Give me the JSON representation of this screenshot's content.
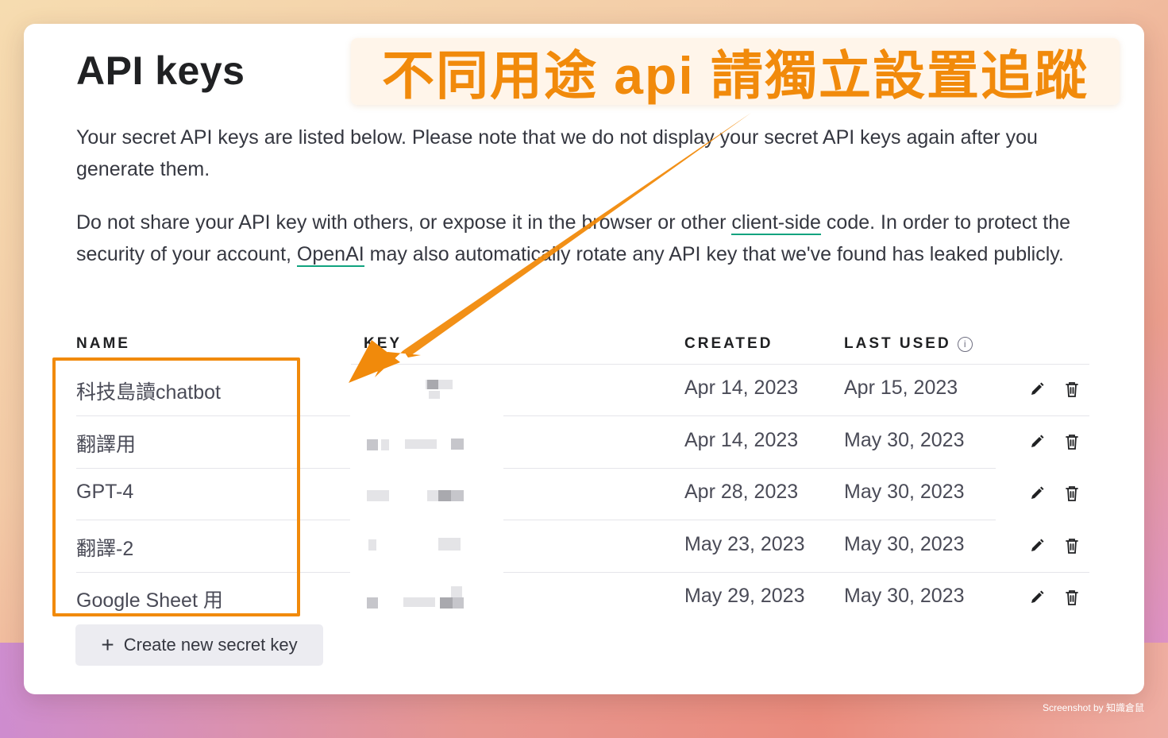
{
  "header": {
    "title": "API keys",
    "annotation_banner": "不同用途 api 請獨立設置追蹤"
  },
  "description": {
    "p1": "Your secret API keys are listed below. Please note that we do not display your secret API keys again after you generate them.",
    "p2_part1": "Do not share your API key with others, or expose it in the browser or other ",
    "p2_link1": "client-side",
    "p2_part2": " code. In order to protect the security of your account, ",
    "p2_link2": "OpenAI",
    "p2_part3": " may also automatically rotate any API key that we've found has leaked publicly."
  },
  "table": {
    "columns": {
      "name": "NAME",
      "key": "KEY",
      "created": "CREATED",
      "last_used": "LAST USED",
      "info_glyph": "i"
    },
    "rows": [
      {
        "name": "科技島讀chatbot",
        "created": "Apr 14, 2023",
        "last_used": "Apr 15, 2023"
      },
      {
        "name": "翻譯用",
        "created": "Apr 14, 2023",
        "last_used": "May 30, 2023"
      },
      {
        "name": "GPT-4",
        "created": "Apr 28, 2023",
        "last_used": "May 30, 2023"
      },
      {
        "name": "翻譯-2",
        "created": "May 23, 2023",
        "last_used": "May 30, 2023"
      },
      {
        "name": "Google Sheet 用",
        "created": "May 29, 2023",
        "last_used": "May 30, 2023"
      }
    ],
    "row_icons": [
      "pencil-icon",
      "trash-icon"
    ]
  },
  "actions": {
    "create_button": "Create new secret key",
    "create_icon": "+"
  },
  "footer": {
    "credit": "Screenshot by 知識倉鼠"
  },
  "colors": {
    "annotation": "#f18a0b",
    "link_underline": "#10a37f",
    "text": "#353740"
  }
}
